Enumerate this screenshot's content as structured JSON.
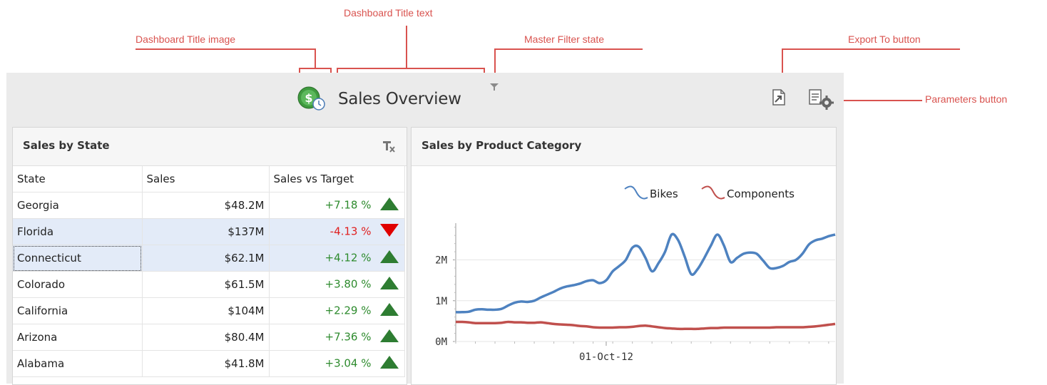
{
  "callouts": {
    "title_image": "Dashboard Title image",
    "title_text": "Dashboard Title text",
    "master_filter": "Master Filter state",
    "export_to": "Export To button",
    "parameters": "Parameters button"
  },
  "dashboard": {
    "title": "Sales Overview"
  },
  "icons": {
    "title_image": "dollar-clock-icon",
    "master_filter": "filter-icon",
    "export": "export-icon",
    "parameters": "parameters-gear-icon",
    "clear_filter": "clear-filter-icon"
  },
  "sales_by_state": {
    "title": "Sales by State",
    "columns": [
      "State",
      "Sales",
      "Sales vs Target"
    ],
    "rows": [
      {
        "state": "Georgia",
        "sales": "$48.2M",
        "delta": "+7.18 %",
        "trend": "up"
      },
      {
        "state": "Florida",
        "sales": "$137M",
        "delta": "-4.13 %",
        "trend": "down"
      },
      {
        "state": "Connecticut",
        "sales": "$62.1M",
        "delta": "+4.12 %",
        "trend": "up"
      },
      {
        "state": "Colorado",
        "sales": "$61.5M",
        "delta": "+3.80 %",
        "trend": "up"
      },
      {
        "state": "California",
        "sales": "$104M",
        "delta": "+2.29 %",
        "trend": "up"
      },
      {
        "state": "Arizona",
        "sales": "$80.4M",
        "delta": "+7.36 %",
        "trend": "up"
      },
      {
        "state": "Alabama",
        "sales": "$41.8M",
        "delta": "+3.04 %",
        "trend": "up"
      }
    ],
    "colors": {
      "up": "#2e7d32",
      "down": "#e00000",
      "selected": "#e3ebf8"
    }
  },
  "sales_by_category": {
    "title": "Sales by Product Category"
  },
  "chart_data": {
    "type": "line",
    "title": "",
    "xlabel": "",
    "ylabel": "",
    "ylim": [
      0,
      2.9
    ],
    "ytick_labels": [
      "0M",
      "1M",
      "2M"
    ],
    "ytick_values": [
      0,
      1,
      2
    ],
    "xtick_labels": [
      "01-Oct-12"
    ],
    "xtick_values": [
      23
    ],
    "legend_position": "top-right",
    "grid": true,
    "x": [
      0,
      1,
      2,
      3,
      4,
      5,
      6,
      7,
      8,
      9,
      10,
      11,
      12,
      13,
      14,
      15,
      16,
      17,
      18,
      19,
      20,
      21,
      22,
      23,
      24,
      25,
      26,
      27,
      28,
      29,
      30,
      31,
      32,
      33,
      34,
      35,
      36,
      37,
      38,
      39,
      40,
      41,
      42,
      43,
      44,
      45,
      46,
      47,
      48,
      49,
      50,
      51,
      52,
      53,
      54,
      55,
      56,
      57,
      58
    ],
    "series": [
      {
        "name": "Bikes",
        "color": "#4e82c0",
        "values": [
          0.72,
          0.72,
          0.73,
          0.78,
          0.79,
          0.78,
          0.78,
          0.8,
          0.88,
          0.95,
          0.98,
          0.97,
          1.0,
          1.08,
          1.15,
          1.22,
          1.3,
          1.35,
          1.38,
          1.42,
          1.48,
          1.5,
          1.43,
          1.5,
          1.72,
          1.85,
          2.0,
          2.3,
          2.32,
          2.05,
          1.72,
          1.92,
          2.2,
          2.62,
          2.48,
          2.08,
          1.65,
          1.78,
          2.05,
          2.35,
          2.62,
          2.35,
          1.95,
          2.05,
          2.15,
          2.18,
          2.15,
          1.98,
          1.8,
          1.8,
          1.85,
          1.95,
          2.0,
          2.15,
          2.38,
          2.48,
          2.52,
          2.58,
          2.62
        ]
      },
      {
        "name": "Components",
        "color": "#c0504d",
        "values": [
          0.48,
          0.48,
          0.47,
          0.45,
          0.45,
          0.45,
          0.45,
          0.46,
          0.48,
          0.47,
          0.47,
          0.46,
          0.46,
          0.47,
          0.45,
          0.43,
          0.42,
          0.41,
          0.4,
          0.38,
          0.37,
          0.35,
          0.34,
          0.34,
          0.34,
          0.35,
          0.35,
          0.36,
          0.38,
          0.39,
          0.37,
          0.35,
          0.33,
          0.32,
          0.31,
          0.31,
          0.31,
          0.31,
          0.32,
          0.33,
          0.33,
          0.34,
          0.34,
          0.34,
          0.34,
          0.34,
          0.34,
          0.34,
          0.34,
          0.35,
          0.35,
          0.35,
          0.35,
          0.35,
          0.36,
          0.37,
          0.39,
          0.41,
          0.43
        ]
      }
    ]
  }
}
